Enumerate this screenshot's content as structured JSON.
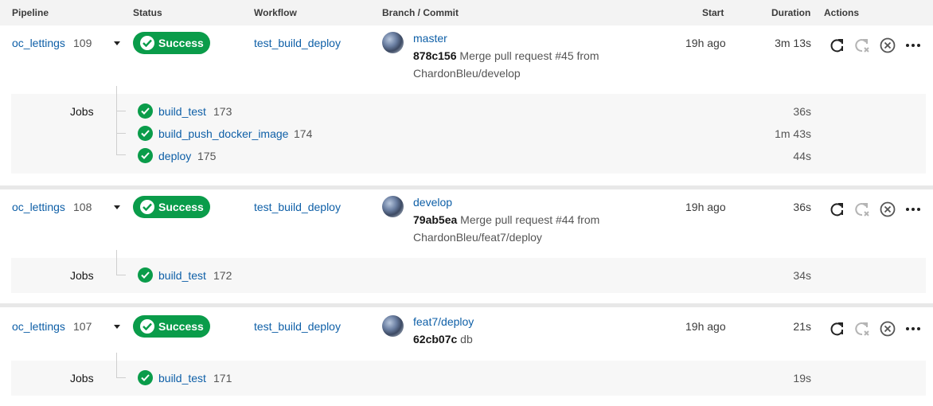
{
  "header": {
    "pipeline": "Pipeline",
    "status": "Status",
    "workflow": "Workflow",
    "branch_commit": "Branch / Commit",
    "start": "Start",
    "duration": "Duration",
    "actions": "Actions"
  },
  "colors": {
    "success": "#0a9c4a",
    "link": "#0e5fa7",
    "jobs_bg": "#f7f7f7",
    "header_bg": "#f3f3f3"
  },
  "icons": [
    "check-icon",
    "rerun-icon",
    "rerun-failed-icon",
    "cancel-icon",
    "more-icon",
    "chevron-down-icon",
    "avatar"
  ],
  "pipelines": [
    {
      "project": "oc_lettings",
      "number": "109",
      "status": "Success",
      "workflow": "test_build_deploy",
      "branch": "master",
      "sha": "878c156",
      "message": "Merge pull request #45 from ChardonBleu/develop",
      "start": "19h ago",
      "duration": "3m 13s",
      "jobs_label": "Jobs",
      "jobs": [
        {
          "name": "build_test",
          "number": "173",
          "duration": "36s"
        },
        {
          "name": "build_push_docker_image",
          "number": "174",
          "duration": "1m 43s"
        },
        {
          "name": "deploy",
          "number": "175",
          "duration": "44s"
        }
      ]
    },
    {
      "project": "oc_lettings",
      "number": "108",
      "status": "Success",
      "workflow": "test_build_deploy",
      "branch": "develop",
      "sha": "79ab5ea",
      "message": "Merge pull request #44 from ChardonBleu/feat7/deploy",
      "start": "19h ago",
      "duration": "36s",
      "jobs_label": "Jobs",
      "jobs": [
        {
          "name": "build_test",
          "number": "172",
          "duration": "34s"
        }
      ]
    },
    {
      "project": "oc_lettings",
      "number": "107",
      "status": "Success",
      "workflow": "test_build_deploy",
      "branch": "feat7/deploy",
      "sha": "62cb07c",
      "message": "db",
      "start": "19h ago",
      "duration": "21s",
      "jobs_label": "Jobs",
      "jobs": [
        {
          "name": "build_test",
          "number": "171",
          "duration": "19s"
        }
      ]
    }
  ]
}
